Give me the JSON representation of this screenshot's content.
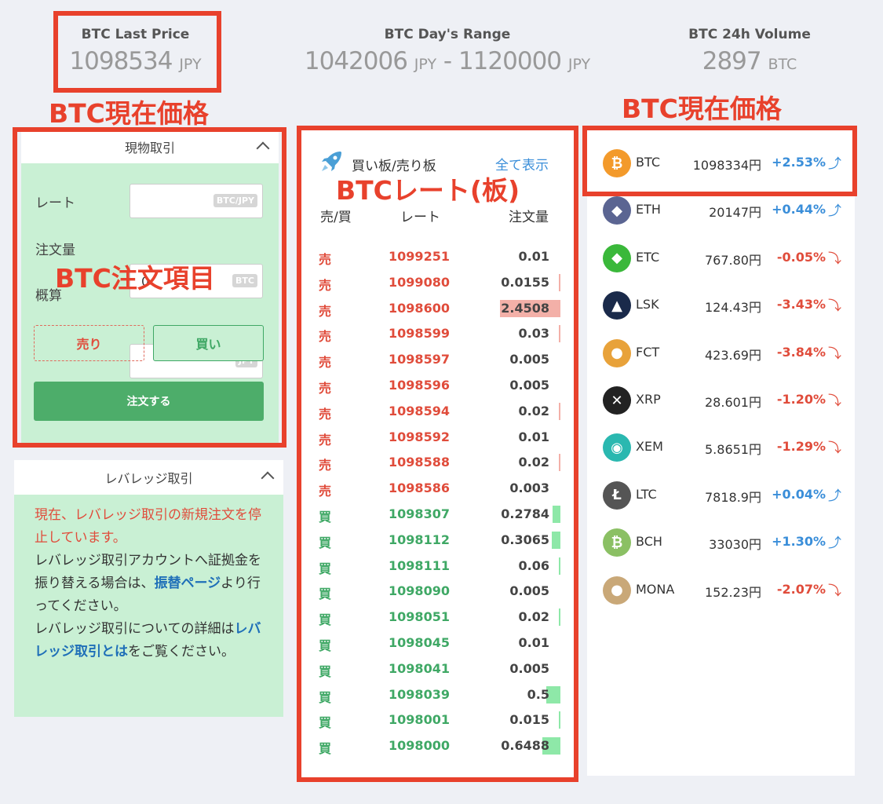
{
  "stats": {
    "last_price": {
      "label": "BTC Last Price",
      "value": "1098534",
      "unit": "JPY"
    },
    "day_range": {
      "label": "BTC Day's Range",
      "low": "1042006",
      "low_unit": "JPY",
      "sep": "-",
      "high": "1120000",
      "high_unit": "JPY"
    },
    "volume": {
      "label": "BTC 24h Volume",
      "value": "2897",
      "unit": "BTC"
    }
  },
  "annotations": {
    "current_price_left": "BTC現在価格",
    "current_price_right": "BTC現在価格",
    "order_items": "BTC注文項目",
    "board": "BTCレート(板)"
  },
  "spot": {
    "title": "現物取引",
    "rate_label": "レート",
    "rate_unit": "BTC/JPY",
    "qty_label": "注文量",
    "qty_value": "0",
    "qty_unit": "BTC",
    "est_label": "概算",
    "est_unit": "JPY",
    "sell_label": "売り",
    "buy_label": "買い",
    "order_label": "注文する"
  },
  "leverage": {
    "title": "レバレッジ取引",
    "notice": "現在、レバレッジ取引の新規注文を停止しています。",
    "line1": "レバレッジ取引アカウントへ証拠金を振り替える場合は、",
    "link1": "振替ページ",
    "line2": "より行ってください。",
    "line3": "レバレッジ取引についての詳細は",
    "link2": "レバレッジ取引とは",
    "line4": "をご覧ください。"
  },
  "orderbook": {
    "title": "買い板/売り板",
    "show_all": "全て表示",
    "col_side": "売/買",
    "col_rate": "レート",
    "col_qty": "注文量",
    "rows": [
      {
        "side": "売",
        "rate": "1099251",
        "qty": "0.01",
        "depth": 0.0
      },
      {
        "side": "売",
        "rate": "1099080",
        "qty": "0.0155",
        "depth": 0.01
      },
      {
        "side": "売",
        "rate": "1098600",
        "qty": "2.4508",
        "depth": 0.7
      },
      {
        "side": "売",
        "rate": "1098599",
        "qty": "0.03",
        "depth": 0.01
      },
      {
        "side": "売",
        "rate": "1098597",
        "qty": "0.005",
        "depth": 0.0
      },
      {
        "side": "売",
        "rate": "1098596",
        "qty": "0.005",
        "depth": 0.0
      },
      {
        "side": "売",
        "rate": "1098594",
        "qty": "0.02",
        "depth": 0.01
      },
      {
        "side": "売",
        "rate": "1098592",
        "qty": "0.01",
        "depth": 0.0
      },
      {
        "side": "売",
        "rate": "1098588",
        "qty": "0.02",
        "depth": 0.01
      },
      {
        "side": "売",
        "rate": "1098586",
        "qty": "0.003",
        "depth": 0.0
      },
      {
        "side": "買",
        "rate": "1098307",
        "qty": "0.2784",
        "depth": 0.09
      },
      {
        "side": "買",
        "rate": "1098112",
        "qty": "0.3065",
        "depth": 0.1
      },
      {
        "side": "買",
        "rate": "1098111",
        "qty": "0.06",
        "depth": 0.02
      },
      {
        "side": "買",
        "rate": "1098090",
        "qty": "0.005",
        "depth": 0.0
      },
      {
        "side": "買",
        "rate": "1098051",
        "qty": "0.02",
        "depth": 0.01
      },
      {
        "side": "買",
        "rate": "1098045",
        "qty": "0.01",
        "depth": 0.0
      },
      {
        "side": "買",
        "rate": "1098041",
        "qty": "0.005",
        "depth": 0.0
      },
      {
        "side": "買",
        "rate": "1098039",
        "qty": "0.5",
        "depth": 0.16
      },
      {
        "side": "買",
        "rate": "1098001",
        "qty": "0.015",
        "depth": 0.01
      },
      {
        "side": "買",
        "rate": "1098000",
        "qty": "0.6488",
        "depth": 0.21
      }
    ],
    "colors": {
      "sell_bar": "#f3b0a8",
      "buy_bar": "#8ee8a8"
    }
  },
  "coins": [
    {
      "symbol": "BTC",
      "price": "1098334円",
      "change": "+2.53%",
      "dir": "up",
      "icon": "bitcoin-icon",
      "color": "#f39a2b",
      "glyph": "₿"
    },
    {
      "symbol": "ETH",
      "price": "20147円",
      "change": "+0.44%",
      "dir": "up",
      "icon": "ethereum-icon",
      "color": "#5b6592",
      "glyph": "◆"
    },
    {
      "symbol": "ETC",
      "price": "767.80円",
      "change": "-0.05%",
      "dir": "down",
      "icon": "ethereum-classic-icon",
      "color": "#3ab83a",
      "glyph": "◆"
    },
    {
      "symbol": "LSK",
      "price": "124.43円",
      "change": "-3.43%",
      "dir": "down",
      "icon": "lisk-icon",
      "color": "#1a2a4a",
      "glyph": "▲"
    },
    {
      "symbol": "FCT",
      "price": "423.69円",
      "change": "-3.84%",
      "dir": "down",
      "icon": "factom-icon",
      "color": "#e8a23a",
      "glyph": "●"
    },
    {
      "symbol": "XRP",
      "price": "28.601円",
      "change": "-1.20%",
      "dir": "down",
      "icon": "ripple-icon",
      "color": "#222222",
      "glyph": "✕"
    },
    {
      "symbol": "XEM",
      "price": "5.8651円",
      "change": "-1.29%",
      "dir": "down",
      "icon": "nem-icon",
      "color": "#2ab8b0",
      "glyph": "◉"
    },
    {
      "symbol": "LTC",
      "price": "7818.9円",
      "change": "+0.04%",
      "dir": "up",
      "icon": "litecoin-icon",
      "color": "#555555",
      "glyph": "Ł"
    },
    {
      "symbol": "BCH",
      "price": "33030円",
      "change": "+1.30%",
      "dir": "up",
      "icon": "bitcoin-cash-icon",
      "color": "#8bc064",
      "glyph": "₿"
    },
    {
      "symbol": "MONA",
      "price": "152.23円",
      "change": "-2.07%",
      "dir": "down",
      "icon": "monacoin-icon",
      "color": "#c9a878",
      "glyph": "●"
    }
  ],
  "arrows": {
    "up": "⤴",
    "down": "⤵"
  }
}
